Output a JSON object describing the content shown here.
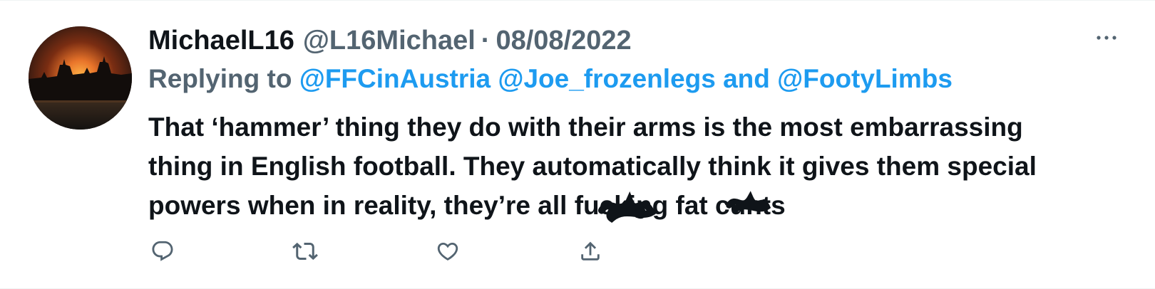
{
  "tweet": {
    "display_name": "MichaelL16",
    "handle": "@L16Michael",
    "separator": "·",
    "date": "08/08/2022",
    "reply": {
      "prefix": "Replying to",
      "mention_1": "@FFCinAustria",
      "mention_2": "@Joe_frozenlegs",
      "conjunction": "and",
      "mention_3": "@FootyLimbs"
    },
    "text": {
      "line_1": "That ‘hammer’ thing they do with their arms is the most embarrassing",
      "line_2": "thing in English football. They automatically think it gives them special",
      "line_3_pre": "powers when in reality, they’re all ",
      "censored_word_1": "fucking",
      "line_3_mid": " fat ",
      "censored_word_2": "cunts"
    },
    "icons": {
      "avatar": "sunset-skyline-avatar",
      "more": "more-options-icon",
      "reply": "reply-icon",
      "retweet": "retweet-icon",
      "like": "like-heart-icon",
      "share": "share-icon"
    },
    "colors": {
      "text_primary": "#0f1419",
      "text_secondary": "#536471",
      "accent": "#1d9bf0",
      "icon": "#536471"
    }
  }
}
